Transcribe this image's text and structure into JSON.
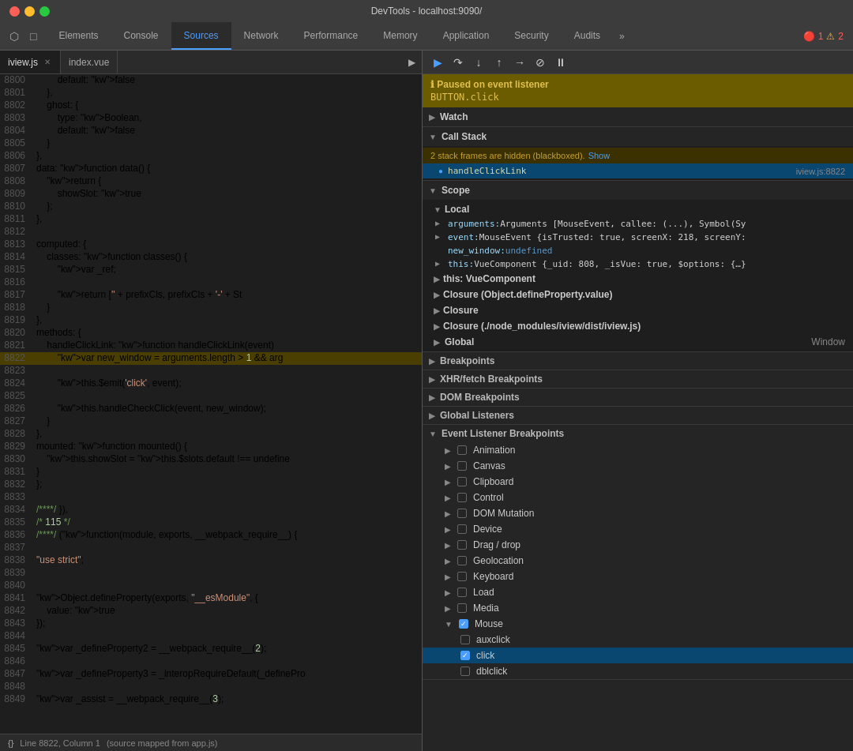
{
  "window": {
    "title": "DevTools - localhost:9090/"
  },
  "titlebar": {
    "title": "DevTools - localhost:9090/"
  },
  "tabs": {
    "items": [
      {
        "id": "elements",
        "label": "Elements",
        "active": false
      },
      {
        "id": "console",
        "label": "Console",
        "active": false
      },
      {
        "id": "sources",
        "label": "Sources",
        "active": true
      },
      {
        "id": "network",
        "label": "Network",
        "active": false
      },
      {
        "id": "performance",
        "label": "Performance",
        "active": false
      },
      {
        "id": "memory",
        "label": "Memory",
        "active": false
      },
      {
        "id": "application",
        "label": "Application",
        "active": false
      },
      {
        "id": "security",
        "label": "Security",
        "active": false
      },
      {
        "id": "audits",
        "label": "Audits",
        "active": false
      }
    ],
    "more_label": "»",
    "error_count": "1",
    "warning_count": "2"
  },
  "file_tabs": {
    "items": [
      {
        "id": "iview",
        "label": "iview.js",
        "active": true
      },
      {
        "id": "index",
        "label": "index.vue",
        "active": false
      }
    ]
  },
  "code": {
    "lines": [
      {
        "num": "8800",
        "content": "        default: false"
      },
      {
        "num": "8801",
        "content": "    },"
      },
      {
        "num": "8802",
        "content": "    ghost: {"
      },
      {
        "num": "8803",
        "content": "        type: Boolean,"
      },
      {
        "num": "8804",
        "content": "        default: false"
      },
      {
        "num": "8805",
        "content": "    }"
      },
      {
        "num": "8806",
        "content": "},"
      },
      {
        "num": "8807",
        "content": "data: function data() {"
      },
      {
        "num": "8808",
        "content": "    return {"
      },
      {
        "num": "8809",
        "content": "        showSlot: true"
      },
      {
        "num": "8810",
        "content": "    };"
      },
      {
        "num": "8811",
        "content": "},"
      },
      {
        "num": "8812",
        "content": ""
      },
      {
        "num": "8813",
        "content": "computed: {"
      },
      {
        "num": "8814",
        "content": "    classes: function classes() {"
      },
      {
        "num": "8815",
        "content": "        var _ref;"
      },
      {
        "num": "8816",
        "content": ""
      },
      {
        "num": "8817",
        "content": "        return ['' + prefixCls, prefixCls + '-' + St"
      },
      {
        "num": "8818",
        "content": "    }"
      },
      {
        "num": "8819",
        "content": "},"
      },
      {
        "num": "8820",
        "content": "methods: {"
      },
      {
        "num": "8821",
        "content": "    handleClickLink: function handleClickLink(event)"
      },
      {
        "num": "8822",
        "content": "        var new_window = arguments.length > 1 && arg",
        "highlighted": true
      },
      {
        "num": "8823",
        "content": ""
      },
      {
        "num": "8824",
        "content": "        this.$emit('click', event);"
      },
      {
        "num": "8825",
        "content": ""
      },
      {
        "num": "8826",
        "content": "        this.handleCheckClick(event, new_window);"
      },
      {
        "num": "8827",
        "content": "    }"
      },
      {
        "num": "8828",
        "content": "},"
      },
      {
        "num": "8829",
        "content": "mounted: function mounted() {"
      },
      {
        "num": "8830",
        "content": "    this.showSlot = this.$slots.default !== undefine"
      },
      {
        "num": "8831",
        "content": "}"
      },
      {
        "num": "8832",
        "content": "};"
      },
      {
        "num": "8833",
        "content": ""
      },
      {
        "num": "8834",
        "content": "/****/ }),"
      },
      {
        "num": "8835",
        "content": "/* 115 */"
      },
      {
        "num": "8836",
        "content": "/****/ (function(module, exports, __webpack_require__) {"
      },
      {
        "num": "8837",
        "content": ""
      },
      {
        "num": "8838",
        "content": "\"use strict\";"
      },
      {
        "num": "8839",
        "content": ""
      },
      {
        "num": "8840",
        "content": ""
      },
      {
        "num": "8841",
        "content": "Object.defineProperty(exports, \"__esModule\", {"
      },
      {
        "num": "8842",
        "content": "    value: true"
      },
      {
        "num": "8843",
        "content": "});"
      },
      {
        "num": "8844",
        "content": ""
      },
      {
        "num": "8845",
        "content": "var _defineProperty2 = __webpack_require__(2);"
      },
      {
        "num": "8846",
        "content": ""
      },
      {
        "num": "8847",
        "content": "var _defineProperty3 = _interopRequireDefault(_definePro"
      },
      {
        "num": "8848",
        "content": ""
      },
      {
        "num": "8849",
        "content": "var _assist = __webpack_require__(3);"
      }
    ]
  },
  "statusbar": {
    "brackets": "{}",
    "text": "Line 8822, Column 1",
    "source_text": "(source mapped from app.js)"
  },
  "debugger": {
    "paused_label": "Paused on event listener",
    "paused_detail": "BUTTON.click",
    "watch_label": "Watch",
    "callstack_label": "Call Stack",
    "hidden_frames_text": "2 stack frames are hidden (blackboxed).",
    "show_label": "Show",
    "stack_frames": [
      {
        "id": "handleClickLink",
        "name": "handleClickLink",
        "loc": "iview.js:8822",
        "selected": true,
        "arrow": true
      }
    ],
    "scope_label": "Scope",
    "scope_sections": [
      {
        "id": "local",
        "label": "Local",
        "expanded": true,
        "items": [
          {
            "key": "arguments",
            "val": "Arguments [MouseEvent, callee: (...), Symbol(Sy",
            "expandable": true
          },
          {
            "key": "event",
            "val": "MouseEvent {isTrusted: true, screenX: 218, screenY:",
            "expandable": true
          },
          {
            "key": "new_window",
            "val": "undefined",
            "expandable": false
          },
          {
            "key": "this",
            "val": "VueComponent {_uid: 808, _isVue: true, $options: {...}",
            "expandable": true
          }
        ]
      },
      {
        "id": "this",
        "label": "this: VueComponent",
        "expandable": true
      },
      {
        "id": "closure_define",
        "label": "Closure (Object.defineProperty.value)",
        "expandable": true
      },
      {
        "id": "closure",
        "label": "Closure",
        "expandable": true
      },
      {
        "id": "closure_path",
        "label": "Closure (./node_modules/iview/dist/iview.js)",
        "expandable": true
      },
      {
        "id": "global",
        "label": "Global",
        "right": "Window",
        "expandable": true
      }
    ],
    "breakpoints_sections": [
      {
        "id": "breakpoints",
        "label": "Breakpoints",
        "expanded": false
      },
      {
        "id": "xhr",
        "label": "XHR/fetch Breakpoints",
        "expanded": false
      },
      {
        "id": "dom",
        "label": "DOM Breakpoints",
        "expanded": false
      },
      {
        "id": "global_listeners",
        "label": "Global Listeners",
        "expanded": false
      }
    ],
    "event_listener_breakpoints_label": "Event Listener Breakpoints",
    "event_listener_sections": [
      {
        "id": "animation",
        "label": "Animation",
        "checked": false,
        "expanded": false
      },
      {
        "id": "canvas",
        "label": "Canvas",
        "checked": false,
        "expanded": false
      },
      {
        "id": "clipboard",
        "label": "Clipboard",
        "checked": false,
        "expanded": false
      },
      {
        "id": "control",
        "label": "Control",
        "checked": false,
        "expanded": false
      },
      {
        "id": "dom_mutation",
        "label": "DOM Mutation",
        "checked": false,
        "expanded": false
      },
      {
        "id": "device",
        "label": "Device",
        "checked": false,
        "expanded": false
      },
      {
        "id": "drag_drop",
        "label": "Drag / drop",
        "checked": false,
        "expanded": false
      },
      {
        "id": "geolocation",
        "label": "Geolocation",
        "checked": false,
        "expanded": false
      },
      {
        "id": "keyboard",
        "label": "Keyboard",
        "checked": false,
        "expanded": false
      },
      {
        "id": "load",
        "label": "Load",
        "checked": false,
        "expanded": false
      },
      {
        "id": "media",
        "label": "Media",
        "checked": false,
        "expanded": false
      },
      {
        "id": "mouse",
        "label": "Mouse",
        "checked": true,
        "expanded": true,
        "children": [
          {
            "id": "auxclick",
            "label": "auxclick",
            "checked": false
          },
          {
            "id": "click",
            "label": "click",
            "checked": true,
            "selected": true
          },
          {
            "id": "dblclick",
            "label": "dblclick",
            "checked": false
          }
        ]
      }
    ]
  }
}
